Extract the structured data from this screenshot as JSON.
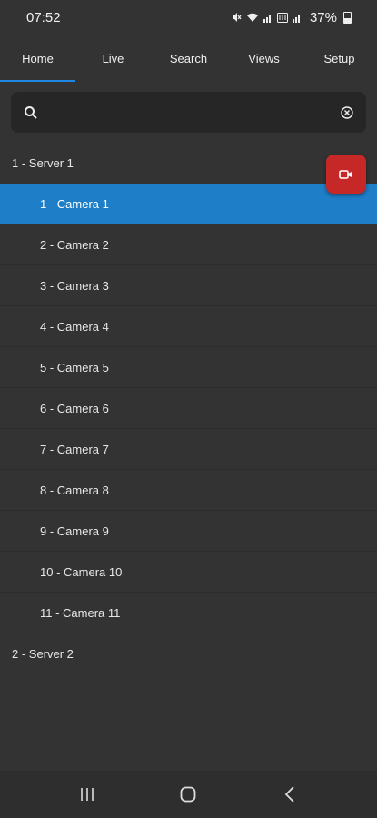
{
  "status_bar": {
    "time": "07:52",
    "battery": "37%",
    "icons": [
      "mute-icon",
      "wifi-icon",
      "signal-icon",
      "volte-icon",
      "signal-icon",
      "battery-icon"
    ]
  },
  "tabs": [
    {
      "label": "Home",
      "active": true
    },
    {
      "label": "Live"
    },
    {
      "label": "Search"
    },
    {
      "label": "Views"
    },
    {
      "label": "Setup"
    }
  ],
  "search": {
    "value": "",
    "placeholder": "",
    "icon": "search-icon",
    "clear_icon": "clear-icon"
  },
  "tree": [
    {
      "label": "1 - Server 1",
      "cameras": [
        {
          "label": "1 - Camera 1",
          "selected": true
        },
        {
          "label": "2 - Camera 2"
        },
        {
          "label": "3 - Camera 3"
        },
        {
          "label": "4 - Camera 4"
        },
        {
          "label": "5 - Camera 5"
        },
        {
          "label": "6 - Camera 6"
        },
        {
          "label": "7 - Camera 7"
        },
        {
          "label": "8 - Camera 8"
        },
        {
          "label": "9 - Camera 9"
        },
        {
          "label": "10 - Camera 10"
        },
        {
          "label": "11 - Camera 11"
        }
      ]
    },
    {
      "label": "2 - Server 2"
    }
  ],
  "record_button": {
    "icon": "video-camera-icon",
    "color": "#c62828"
  },
  "colors": {
    "accent": "#1e88e5",
    "selected_row": "#1e7ec8",
    "background": "#333333"
  },
  "nav_bar": {
    "icons": [
      "recents-icon",
      "home-icon",
      "back-icon"
    ]
  }
}
